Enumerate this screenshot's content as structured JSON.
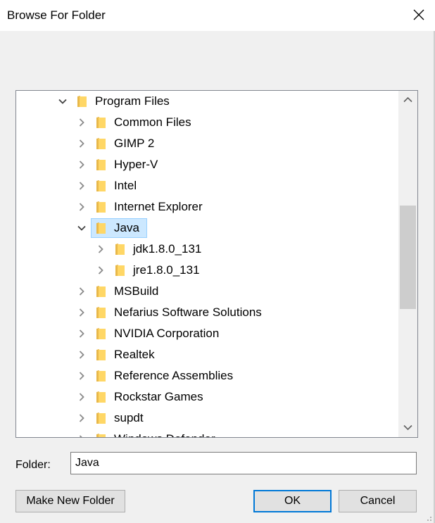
{
  "window": {
    "title": "Browse For Folder"
  },
  "tree": {
    "rows": [
      {
        "label": "Program Files",
        "expanded": true,
        "level": 0,
        "selected": false
      },
      {
        "label": "Common Files",
        "expanded": false,
        "level": 1,
        "selected": false
      },
      {
        "label": "GIMP 2",
        "expanded": false,
        "level": 1,
        "selected": false
      },
      {
        "label": "Hyper-V",
        "expanded": false,
        "level": 1,
        "selected": false
      },
      {
        "label": "Intel",
        "expanded": false,
        "level": 1,
        "selected": false
      },
      {
        "label": "Internet Explorer",
        "expanded": false,
        "level": 1,
        "selected": false
      },
      {
        "label": "Java",
        "expanded": true,
        "level": 1,
        "selected": true
      },
      {
        "label": "jdk1.8.0_131",
        "expanded": false,
        "level": 2,
        "selected": false
      },
      {
        "label": "jre1.8.0_131",
        "expanded": false,
        "level": 2,
        "selected": false
      },
      {
        "label": "MSBuild",
        "expanded": false,
        "level": 1,
        "selected": false
      },
      {
        "label": "Nefarius Software Solutions",
        "expanded": false,
        "level": 1,
        "selected": false
      },
      {
        "label": "NVIDIA Corporation",
        "expanded": false,
        "level": 1,
        "selected": false
      },
      {
        "label": "Realtek",
        "expanded": false,
        "level": 1,
        "selected": false
      },
      {
        "label": "Reference Assemblies",
        "expanded": false,
        "level": 1,
        "selected": false
      },
      {
        "label": "Rockstar Games",
        "expanded": false,
        "level": 1,
        "selected": false
      },
      {
        "label": "supdt",
        "expanded": false,
        "level": 1,
        "selected": false
      },
      {
        "label": "Windows Defender",
        "expanded": false,
        "level": 1,
        "selected": false
      }
    ]
  },
  "folder_field": {
    "label": "Folder:",
    "value": "Java"
  },
  "buttons": {
    "make_new_folder": "Make New Folder",
    "ok": "OK",
    "cancel": "Cancel"
  },
  "colors": {
    "selection_bg": "#cce8ff",
    "selection_border": "#99d1ff",
    "folder_yellow": "#ffd766",
    "default_button_border": "#0078d7"
  }
}
